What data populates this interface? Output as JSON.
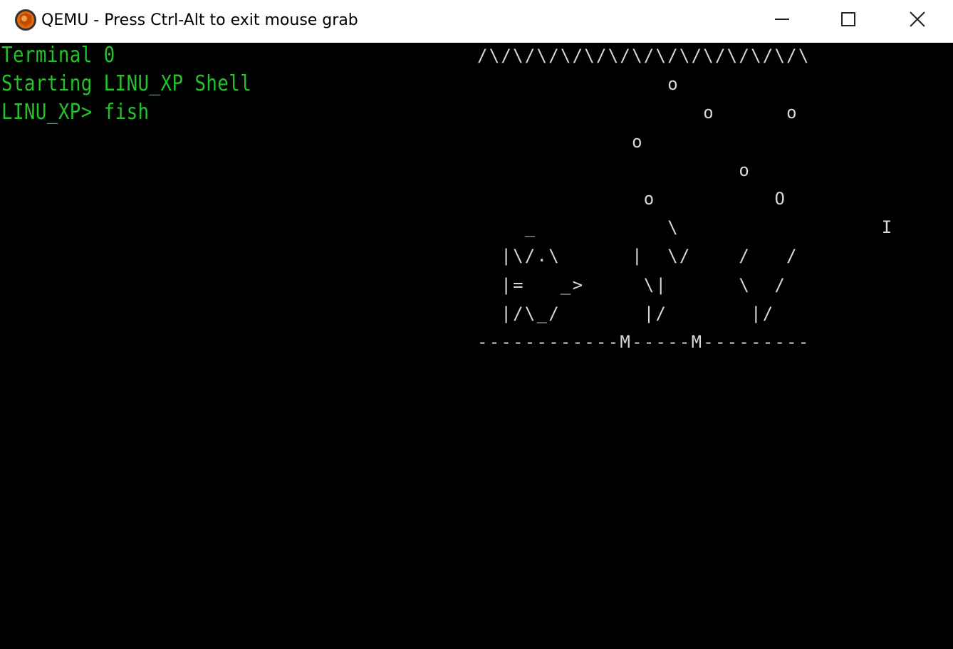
{
  "window": {
    "title": "QEMU - Press Ctrl-Alt to exit mouse grab",
    "icon": "qemu-logo-icon",
    "controls": {
      "minimize_icon": "minimize-icon",
      "maximize_icon": "maximize-icon",
      "close_icon": "close-icon"
    }
  },
  "terminal": {
    "lines": [
      "Terminal 0",
      "Starting LINU_XP Shell",
      "LINU_XP> fish"
    ],
    "text_color": "#22c22a",
    "background": "#000000"
  },
  "aquarium": {
    "art": "/\\/\\/\\/\\/\\/\\/\\/\\/\\/\\/\\/\\/\\/\\\n                o\n                   o      o\n             o\n                      o\n              o          O\n    _           \\                 I\n  |\\/.\\      |  \\/    /   /\n  |=   _>     \\|      \\  /\n  |/\\_/       |/       |/\n------------M-----M---------",
    "color": "#d8d8d8"
  }
}
